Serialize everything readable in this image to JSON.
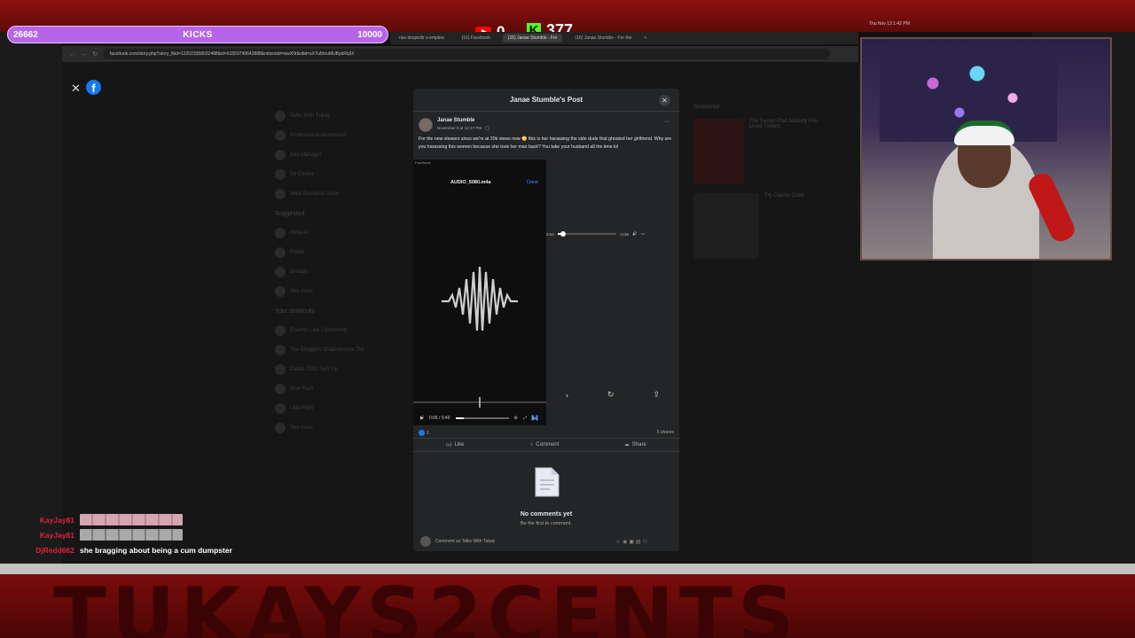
{
  "overlay": {
    "goal_current": "26662",
    "goal_title": "KICKS",
    "goal_target": "10000",
    "youtube_count": "0",
    "kick_count": "377",
    "kick_letter": "K"
  },
  "browser": {
    "tabs": [
      "rias despedir a emplea",
      "(16) Facebook",
      "(16) Janae Stumble - For",
      "(16) Janae Stumble - For the"
    ],
    "url": "facebook.com/story.php?story_fbid=122023358032488&id=61559749642888&mibextid=wwXIfr&rdid=sXYu5hruMUBybRq3#",
    "datetime": "Thu Nov 13  1:42 PM"
  },
  "fb_background": {
    "sidebar_items": [
      "Talks With Tukay",
      "Professional dashboard",
      "Ads Manager",
      "Ad Center",
      "Meta Business Suite"
    ],
    "suggested_heading": "Suggested",
    "suggested_items": [
      "Meta AI",
      "Feeds",
      "Groups",
      "See more"
    ],
    "shortcuts_heading": "Your shortcuts",
    "shortcut_items": [
      "Ecamm Live Community",
      "The Bloggers Shadowroom TM",
      "Dallas TOD Turn Up",
      "Now Ram",
      "I AM HER",
      "See more"
    ],
    "sponsored_heading": "Sponsored",
    "ads": [
      {
        "title": "The Secret That Nobody Pre-Lined Tickets"
      },
      {
        "title": "Try Classic Cook"
      }
    ]
  },
  "post": {
    "modal_title": "Janae Stumble's Post",
    "author": "Janae Stumble",
    "date": "November 8 at 12:17 PM · ",
    "text": "For the new viewers since we're at 20k views now 😳 this is her harassing the side dude that ghosted her girlfriend. Why are you harassing this women because she took her man back? You take your husband all the time lol",
    "phone_source": "Facebook",
    "audio_file": "AUDIO_5080.m4a",
    "done_label": "Done",
    "player_elapsed": "0:04",
    "player_remaining": "-0:36",
    "player_progress": 0.1,
    "video_time": "0:06 / 0:40",
    "video_progress": 0.15,
    "reaction_count": "1",
    "shares": "5 shares",
    "actions": {
      "like": "Like",
      "comment": "Comment",
      "share": "Share"
    },
    "no_comments": "No comments yet",
    "be_first": "Be the first to comment.",
    "comment_placeholder": "Comment as Talks With Tukay"
  },
  "chat": [
    {
      "user": "KayJay81",
      "message": "",
      "emote": "pink"
    },
    {
      "user": "KayJay81",
      "message": "",
      "emote": "gray"
    },
    {
      "user": "DjRedd662",
      "message": "she bragging about being a cum dumpster",
      "emote": ""
    }
  ],
  "branding": {
    "bottom_text": "TUKAYS2CENTS"
  },
  "colors": {
    "kick_green": "#53fc18",
    "facebook_blue": "#1877f2",
    "goal_purple": "#b665e8",
    "frame_red": "#8e1010"
  }
}
